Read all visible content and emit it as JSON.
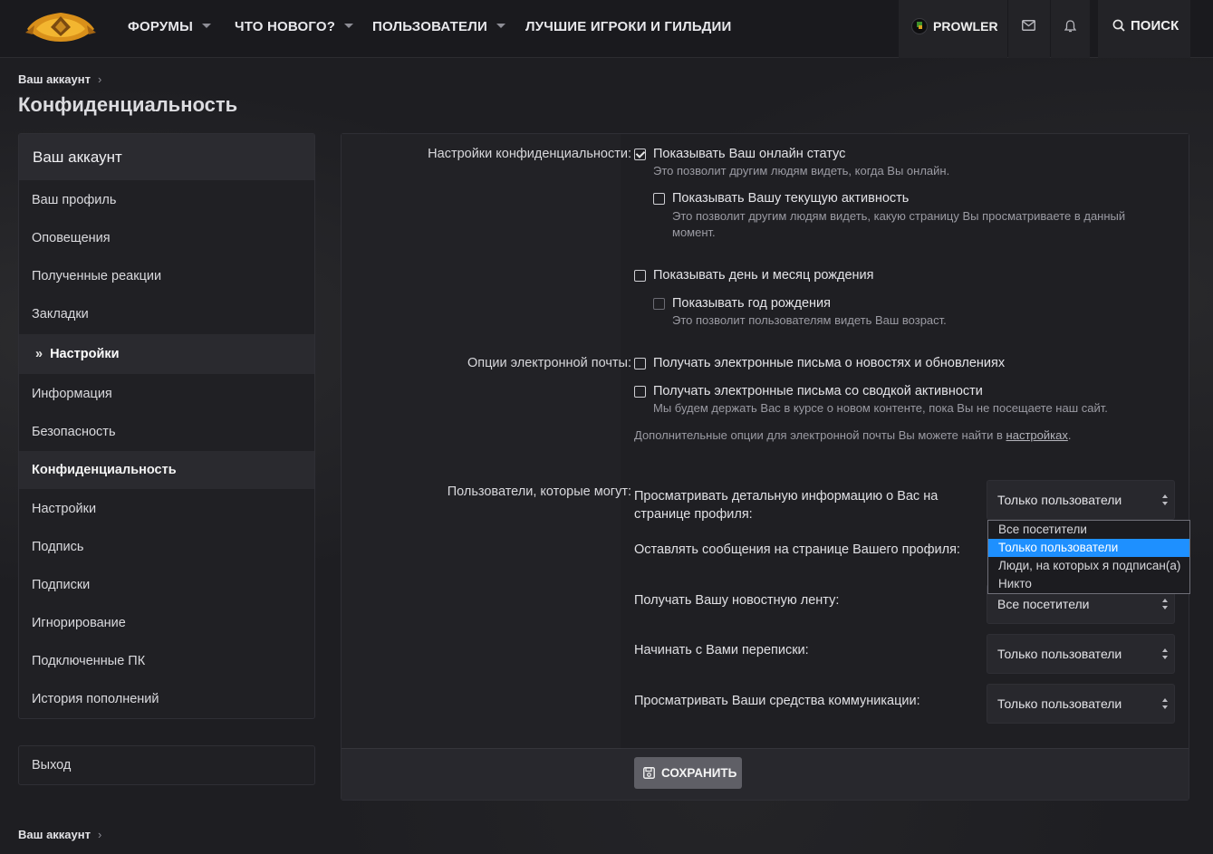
{
  "header": {
    "nav": [
      {
        "label": "ФОРУМЫ",
        "dropdown": true
      },
      {
        "label": "ЧТО НОВОГО?",
        "dropdown": true
      },
      {
        "label": "ПОЛЬЗОВАТЕЛИ",
        "dropdown": true
      },
      {
        "label": "ЛУЧШИЕ ИГРОКИ И ГИЛЬДИИ",
        "dropdown": false
      }
    ],
    "user_name": "PROWLER",
    "search_label": "ПОИСК",
    "icons": [
      "logo",
      "mail-icon",
      "bell-icon",
      "search-icon"
    ]
  },
  "breadcrumb": {
    "label": "Ваш аккаунт",
    "sep": "›"
  },
  "page_title": "Конфиденциальность",
  "sidebar": {
    "title": "Ваш аккаунт",
    "items": [
      {
        "label": "Ваш профиль"
      },
      {
        "label": "Оповещения"
      },
      {
        "label": "Полученные реакции"
      },
      {
        "label": "Закладки"
      },
      {
        "label": "Настройки",
        "state": "expanded",
        "prefix": "»"
      },
      {
        "label": "Информация"
      },
      {
        "label": "Безопасность"
      },
      {
        "label": "Конфиденциальность",
        "state": "current"
      },
      {
        "label": "Настройки"
      },
      {
        "label": "Подпись"
      },
      {
        "label": "Подписки"
      },
      {
        "label": "Игнорирование"
      },
      {
        "label": "Подключенные ПК"
      },
      {
        "label": "История пополнений"
      }
    ],
    "logout": "Выход"
  },
  "form": {
    "privacy": {
      "label": "Настройки конфиденциальности:",
      "show_online": {
        "label": "Показывать Ваш онлайн статус",
        "checked": true,
        "hint": "Это позволит другим людям видеть, когда Вы онлайн."
      },
      "show_activity": {
        "label": "Показывать Вашу текущую активность",
        "checked": false,
        "hint_1": "Это позволит другим людям видеть, какую страницу Вы просматриваете в данный",
        "hint_2": "момент."
      },
      "show_birthday": {
        "label": "Показывать день и месяц рождения",
        "checked": false
      },
      "show_birth_year": {
        "label": "Показывать год рождения",
        "checked": false,
        "disabled": true,
        "hint": "Это позволит пользователям видеть Ваш возраст."
      }
    },
    "email": {
      "label": "Опции электронной почты:",
      "news": {
        "label": "Получать электронные письма о новостях и обновлениях",
        "checked": false
      },
      "digest": {
        "label": "Получать электронные письма со сводкой активности",
        "checked": false,
        "hint": "Мы будем держать Вас в курсе о новом контенте, пока Вы не посещаете наш сайт."
      },
      "more_text": "Дополнительные опции для электронной почты Вы можете найти в ",
      "more_link": "настройках",
      "more_end": "."
    },
    "permissions": {
      "label": "Пользователи, которые могут:",
      "rows": [
        {
          "label_1": "Просматривать детальную информацию о Вас на",
          "label_2": "странице профиля:",
          "value": "Только пользователи"
        },
        {
          "label_1": "Оставлять сообщения на странице Вашего профиля:",
          "value": "Только пользователи"
        },
        {
          "label_1": "Получать Вашу новостную ленту:",
          "value": "Все посетители"
        },
        {
          "label_1": "Начинать с Вами переписки:",
          "value": "Только пользователи"
        },
        {
          "label_1": "Просматривать Ваши средства коммуникации:",
          "value": "Только пользователи"
        }
      ],
      "dropdown_options": [
        "Все посетители",
        "Только пользователи",
        "Люди, на которых я подписан(а)",
        "Никто"
      ],
      "dropdown_selected": "Только пользователи"
    },
    "save_label": "СОХРАНИТЬ"
  },
  "colors": {
    "accent": "#1e90ff",
    "button": "#5f5f66",
    "background": "#1d1d21"
  }
}
